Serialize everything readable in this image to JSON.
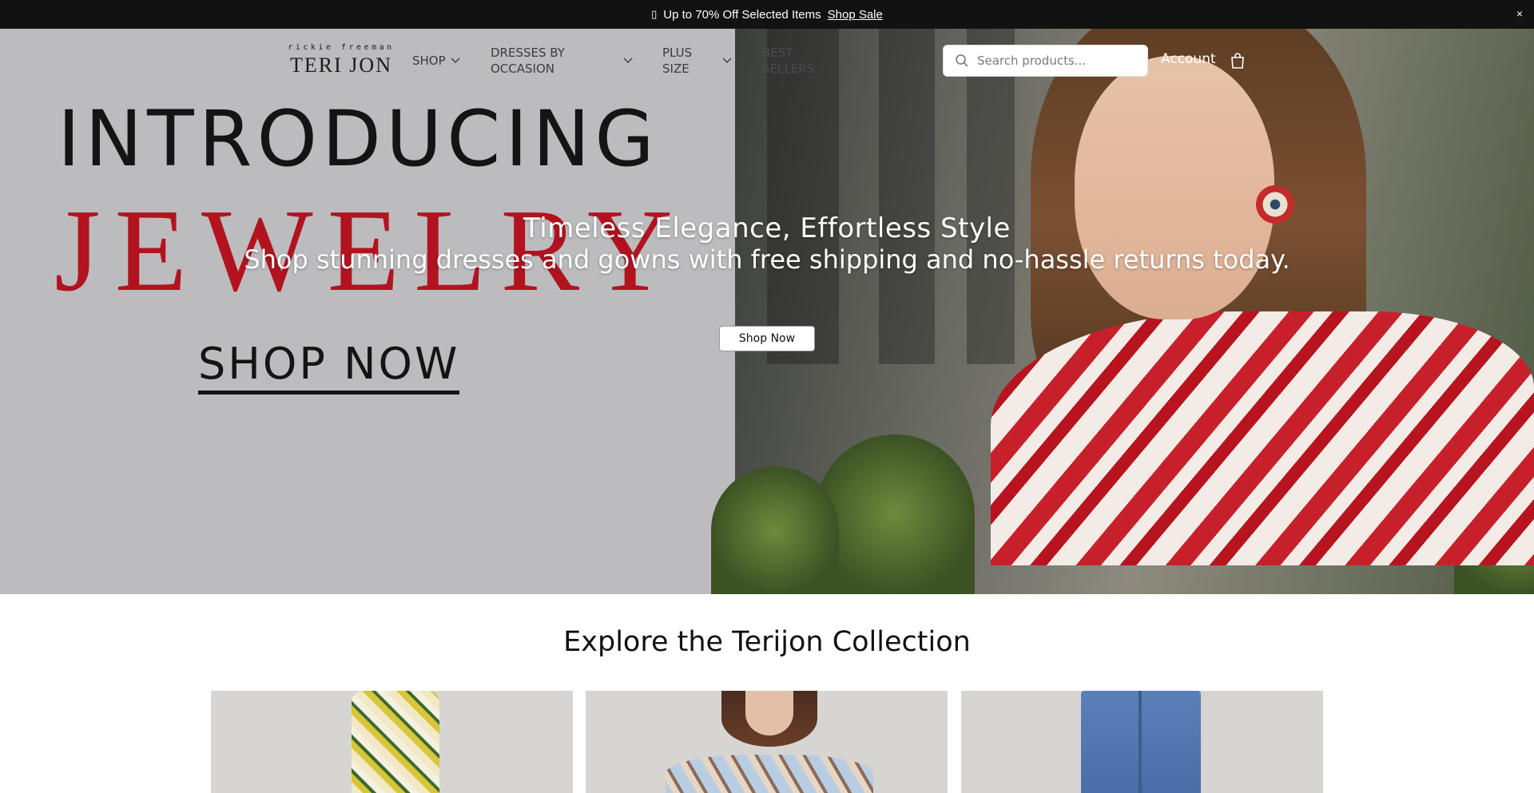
{
  "announcement": {
    "gift_icon": "gift-icon",
    "text": "Up to 70% Off Selected Items",
    "link": "Shop Sale",
    "close": "×"
  },
  "header": {
    "logo_small": "rickie freeman",
    "logo_big": "TERI JON",
    "nav": [
      {
        "label": "SHOP"
      },
      {
        "label": "DRESSES BY OCCASION"
      },
      {
        "label": "PLUS SIZE"
      },
      {
        "label": "BEST SELLERS"
      }
    ],
    "search_placeholder": "Search products...",
    "account": "Account",
    "cart_icon": "shopping-bag-icon"
  },
  "hero": {
    "banner_line1": "INTRODUCING",
    "banner_line2": "JEWELRY",
    "banner_line3": "SHOP NOW",
    "title": "Timeless Elegance, Effortless Style",
    "subtitle": "Shop stunning dresses and gowns with free shipping and no-hassle returns today.",
    "button": "Shop Now"
  },
  "collection": {
    "title": "Explore the Terijon Collection",
    "cards": [
      {
        "name": "yellow-floral-shirt-dress"
      },
      {
        "name": "light-blue-scarf-print-dress"
      },
      {
        "name": "blue-tweed-jacket"
      }
    ]
  },
  "colors": {
    "announce_bg": "#121212",
    "accent_red": "#b2131f",
    "nav_text": "#3a3a48"
  }
}
